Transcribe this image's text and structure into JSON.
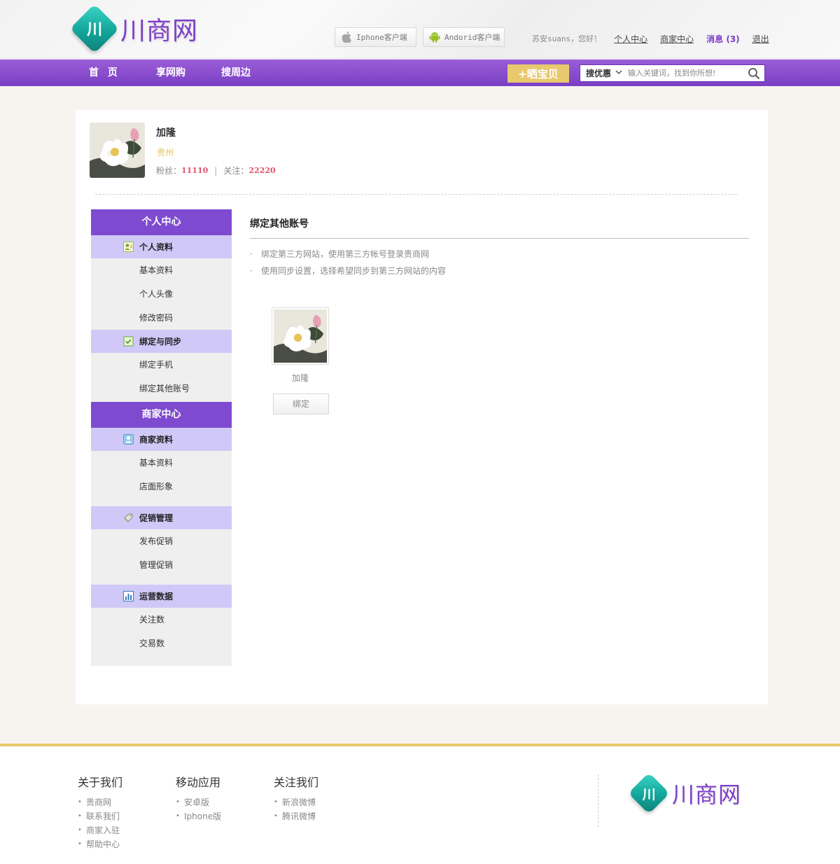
{
  "brand": {
    "logo_mark": "川",
    "logo_text": "川商网",
    "accent": "#7e4bd0",
    "gold": "#e8c96e"
  },
  "header": {
    "client_iphone": "Iphone客户端",
    "client_android": "Andorid客户端",
    "greeting": "苏安suans，您好！",
    "links": {
      "personal": "个人中心",
      "merchant": "商家中心",
      "messages": "消息 (3)",
      "logout": "退出"
    }
  },
  "nav": {
    "home": "首 页",
    "shop": "享网购",
    "nearby": "搜周边",
    "share_button": "+晒宝贝",
    "search_type": "搜优惠",
    "search_placeholder": "输入关键词，找到你所想!"
  },
  "profile": {
    "name": "加隆",
    "city": "贵州",
    "fans_label": "粉丝：",
    "fans": "11110",
    "follow_label": "关注：",
    "follow": "22220"
  },
  "sidebar": {
    "personal_center": "个人中心",
    "personal_info": "个人资料",
    "basic_info": "基本资料",
    "avatar": "个人头像",
    "change_password": "修改密码",
    "bind_sync": "绑定与同步",
    "bind_phone": "绑定手机",
    "bind_other": "绑定其他账号",
    "merchant_center": "商家中心",
    "merchant_info": "商家资料",
    "merchant_basic": "基本资料",
    "store_image": "店面形象",
    "promo_manage": "促销管理",
    "publish_promo": "发布促销",
    "manage_promo": "管理促销",
    "ops_data": "运营数据",
    "follow_count": "关注数",
    "trade_count": "交易数"
  },
  "content": {
    "title": "绑定其他账号",
    "tips": [
      "绑定第三方网站，使用第三方帐号登录贵商网",
      "使用同步设置，选择希望同步到第三方网站的内容"
    ],
    "account_name": "加隆",
    "bind_button": "绑定"
  },
  "footer": {
    "about": {
      "title": "关于我们",
      "items": [
        "贵商网",
        "联系我们",
        "商家入驻",
        "帮助中心"
      ]
    },
    "mobile": {
      "title": "移动应用",
      "items": [
        "安卓版",
        "Iphone版"
      ]
    },
    "follow": {
      "title": "关注我们",
      "items": [
        "新浪微博",
        "腾讯微博"
      ]
    }
  }
}
